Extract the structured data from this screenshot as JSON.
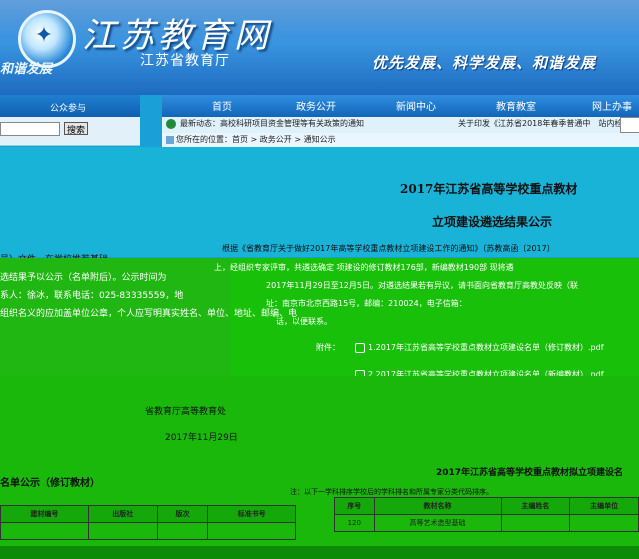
{
  "banner": {
    "brand_calligraphy": "江苏教育网",
    "department": "江苏省教育厅",
    "slogan": "优先发展、科学发展、和谐发展",
    "left_partial": "和谐发展",
    "logo_icon": "seal-icon"
  },
  "nav": {
    "left_item": "公众参与",
    "items": [
      "首页",
      "政务公开",
      "新闻中心",
      "教育教室",
      "网上办事"
    ]
  },
  "search_left": {
    "button": "搜索"
  },
  "notice": {
    "label": "最新动态：",
    "text": "高校科研项目资金管理等有关政策的通知",
    "right_text": "关于印发《江苏省2018年春季普通中",
    "site_search": "站内检索："
  },
  "breadcrumb": "您所在的位置：首页 > 政务公开 > 通知公示",
  "article": {
    "title1": "2017年江苏省高等学校重点教材",
    "title2": "立项建设遴选结果公示",
    "para1": "根据《省教育厅关于做好2017年高等学校重点教材立项建设工作的通知》（苏教高函〔2017〕",
    "para2": "上，经组织专家评审，共遴选确定    项建设的修订教材176部，新编教材190部        现将遴",
    "para3": "2017年11月29日至12月5日。对遴选结果若有异议，请书面向省教育厅高教处反映（联",
    "para4": "址：南京市北京西路15号，邮编：210024，电子信箱：",
    "para5": "话，以便联系。",
    "left1": "号）文件，在学校推荐基础",
    "left2": "选结果予以公示（名单附后）。公示时间为",
    "left3": "系人：徐冰，联系电话：025-83335559，地",
    "left4": "组织名义的应加盖单位公章，个人应写明真实姓名、单位、地址、邮编、电",
    "attachment_label": "附件：",
    "attachment1": "1.2017年江苏省高等学校重点教材立项建设名单（修订教材）.pdf",
    "attachment2": "2.2017年江苏省高等学校重点教材立项建设名单（新编教材）.pdf",
    "signature": "省教育厅高等教育处",
    "date": "2017年11月29日"
  },
  "lists": {
    "left_title": "名单公示（修订教材）",
    "right_title": "2017年江苏省高等学校重点教材拟立项建设名",
    "right_note": "注：以下一学科排序学校后的学科排名和所属专家分类代码排序。",
    "left_headers": [
      "建材编号",
      "出版社",
      "版次",
      "标准书号"
    ],
    "right_headers": [
      "序号",
      "教材名称",
      "主编姓名",
      "主编单位"
    ],
    "right_rows": [
      [
        "120",
        "高等艺术造型基础",
        "",
        ""
      ]
    ]
  }
}
